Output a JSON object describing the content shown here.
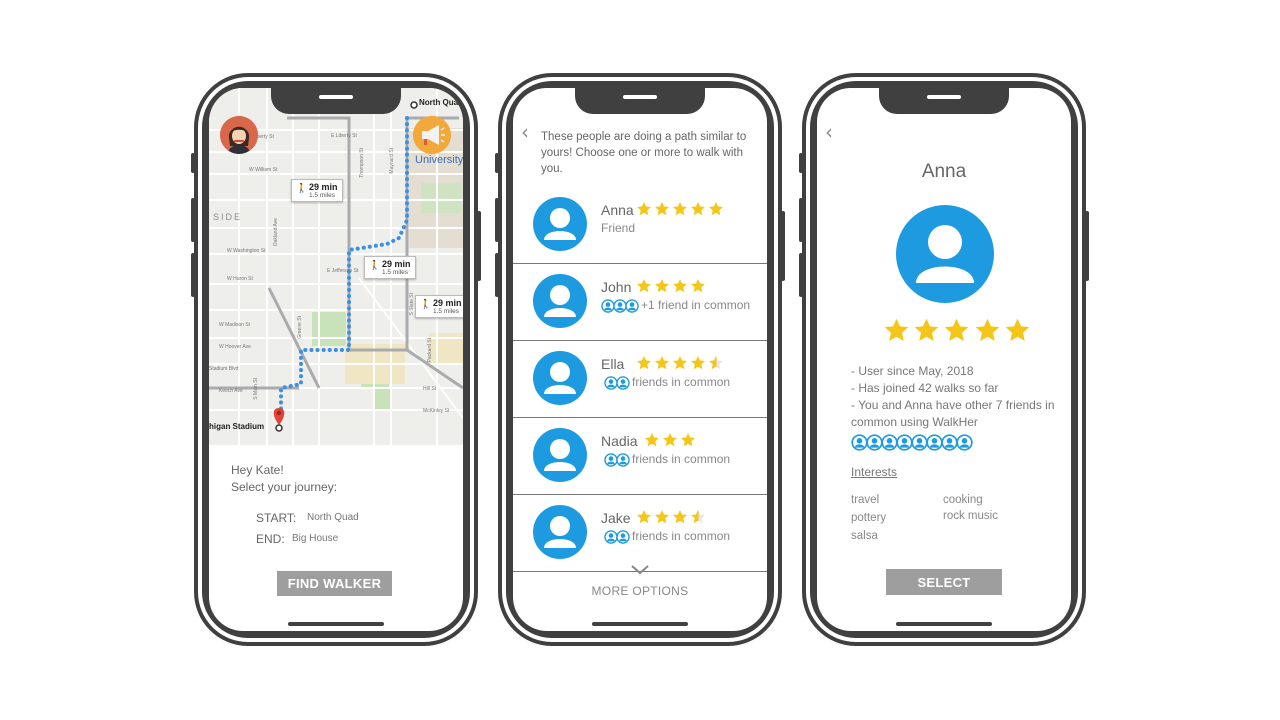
{
  "colors": {
    "phone_frame": "#404040",
    "accent_blue": "#1e9be0",
    "star_yellow": "#f5c518",
    "button_gray": "#9e9e9e",
    "route_blue": "#3d8fe0"
  },
  "screen1": {
    "map": {
      "place_top_right": "North Quad Residence",
      "place_bottom_left": "higan Stadium",
      "university": "University of Michigan",
      "area_label": "SIDE",
      "streets": [
        "E Liberty St",
        "W Liberty St",
        "W William St",
        "Thompson St",
        "Maynard St",
        "S State St",
        "W Washington St",
        "W Huron St",
        "E Jefferson St",
        "W Madison St",
        "Davis Ave",
        "W Hoover Ave",
        "Fuller St",
        "Keech Ave",
        "Greene St",
        "Packard St",
        "S Main St",
        "Kipke Dr",
        "Stadium Blvd",
        "W Hill St",
        "Lawrence Blvd",
        "E Madison St",
        "Hill St",
        "McKinley St",
        "Oakland Ave"
      ],
      "route_cards": [
        {
          "time": "29 min",
          "distance": "1.5 miles"
        },
        {
          "time": "29 min",
          "distance": "1.5 miles"
        },
        {
          "time": "29 min",
          "distance": "1.5 miles"
        }
      ]
    },
    "greeting": "Hey Kate!",
    "prompt": "Select your journey:",
    "start_label": "START:",
    "start_value": "North Quad",
    "end_label": "END:",
    "end_value": "Big House",
    "find_button": "FIND WALKER"
  },
  "screen2": {
    "intro": "These people are doing a path similar to yours! Choose one or more to walk with you.",
    "people": [
      {
        "name": "Anna",
        "rating": 5,
        "subtitle": "Friend",
        "bubbles": 0
      },
      {
        "name": "John",
        "rating": 4,
        "subtitle": "+1 friend in common",
        "bubbles": 3
      },
      {
        "name": "Ella",
        "rating": 4.5,
        "subtitle": "friends in common",
        "bubbles": 2
      },
      {
        "name": "Nadia",
        "rating": 3,
        "subtitle": "friends in common",
        "bubbles": 2
      },
      {
        "name": "Jake",
        "rating": 3.5,
        "subtitle": "friends in common",
        "bubbles": 2
      }
    ],
    "more_options": "MORE OPTIONS"
  },
  "screen3": {
    "name": "Anna",
    "rating": 5,
    "facts": [
      "- User since May, 2018",
      "- Has joined 42 walks so far",
      "- You and Anna have other 7 friends in common using WalkHer"
    ],
    "friend_bubbles": 8,
    "interests_heading": "Interests",
    "interests_col1": [
      "travel",
      "pottery",
      "salsa"
    ],
    "interests_col2": [
      "cooking",
      "rock music"
    ],
    "select_button": "SELECT"
  }
}
